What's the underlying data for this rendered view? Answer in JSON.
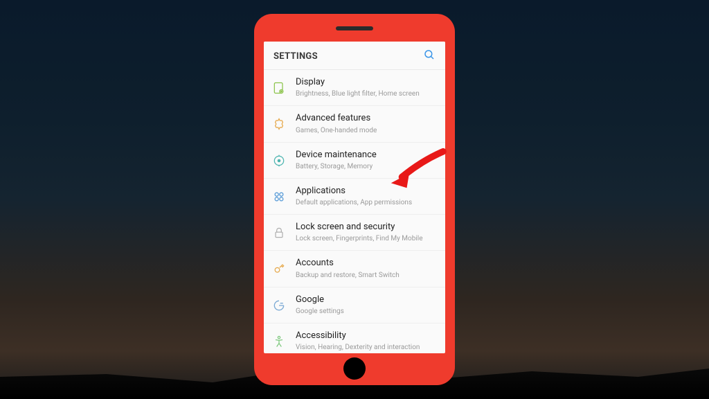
{
  "header": {
    "title": "SETTINGS"
  },
  "items": [
    {
      "title": "Display",
      "sub": "Brightness, Blue light filter, Home screen"
    },
    {
      "title": "Advanced features",
      "sub": "Games, One-handed mode"
    },
    {
      "title": "Device maintenance",
      "sub": "Battery, Storage, Memory"
    },
    {
      "title": "Applications",
      "sub": "Default applications, App permissions"
    },
    {
      "title": "Lock screen and security",
      "sub": "Lock screen, Fingerprints, Find My Mobile"
    },
    {
      "title": "Accounts",
      "sub": "Backup and restore, Smart Switch"
    },
    {
      "title": "Google",
      "sub": "Google settings"
    },
    {
      "title": "Accessibility",
      "sub": "Vision, Hearing, Dexterity and interaction"
    }
  ]
}
